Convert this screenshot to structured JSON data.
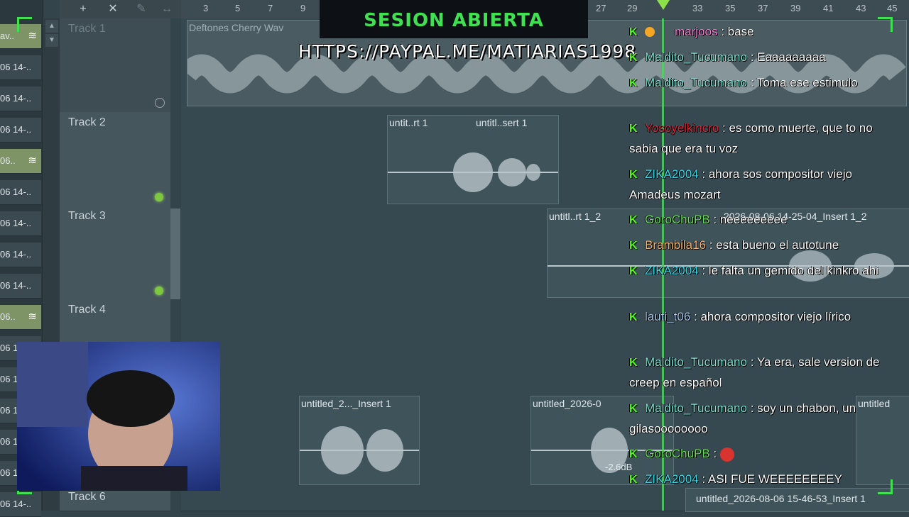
{
  "toolbar": {
    "add_icon": "+",
    "cut_icon": "✕",
    "pencil_icon": "✎",
    "stretch_icon": "↔"
  },
  "ruler": {
    "ticks": [
      "3",
      "5",
      "7",
      "9",
      "27",
      "29",
      "33",
      "35",
      "37",
      "39",
      "41",
      "43",
      "45"
    ]
  },
  "browser": {
    "items": [
      "av..",
      "06 14-..",
      "06 14-..",
      "06 14-..",
      "06..",
      "06 14-..",
      "06 14-..",
      "06 14-..",
      "06 14-..",
      "06..",
      "06 1",
      "06 1",
      "06 1",
      "06 1",
      "06 1",
      "06 14-.."
    ]
  },
  "tracks": [
    {
      "name": "Track 1"
    },
    {
      "name": "Track 2"
    },
    {
      "name": "Track 3"
    },
    {
      "name": "Track 4"
    },
    {
      "name": "Track 6"
    }
  ],
  "clips": {
    "t1_title": "Deftones  Cherry Wav",
    "t2_a": "untit..rt 1",
    "t2_b": "untitl..sert 1",
    "t3_a": "untitl..rt 1_2",
    "t3_b": "2026-08-06 14-25-04_Insert 1_2",
    "t5_a": "untitled_2..._Insert 1",
    "t5_b": "untitled_2026-0",
    "t5_c": "untitled",
    "t6_a": "untitled_2026-08-06 15-46-53_Insert 1",
    "db_label": "-2.6dB"
  },
  "overlay": {
    "banner": "SESION ABIERTA",
    "paypal": "HTTPS://PAYPAL.ME/MATIARIAS1998"
  },
  "chat": [
    {
      "user": "marjoos",
      "color": "#ff7ad9",
      "text": ": base"
    },
    {
      "user": "Maldito_Tucumano",
      "color": "#7be3d2",
      "text": ": Eaaaaaaaaa"
    },
    {
      "user": "Maldito_Tucumano",
      "color": "#7be3d2",
      "text": ": Toma ese estimulo"
    },
    {
      "user": "Yosoyelkincro",
      "color": "#e0253a",
      "text": ": es como muerte, que to no sabia que era tu voz"
    },
    {
      "user": "ZIKA2004",
      "color": "#36d9e8",
      "text": ": ahora sos compositor viejo Amadeus mozart"
    },
    {
      "user": "GoroChuPB",
      "color": "#62e04f",
      "text": ": neeeeeeeee"
    },
    {
      "user": "Brambila16",
      "color": "#f4b470",
      "text": ": esta bueno el autotune"
    },
    {
      "user": "ZIKA2004",
      "color": "#36d9e8",
      "text": ": le falta un gemido del kinkro ahi"
    },
    {
      "user": "lauti_t06",
      "color": "#a6c8ee",
      "text": ": ahora compositor viejo lírico"
    },
    {
      "user": "Maldito_Tucumano",
      "color": "#7be3d2",
      "text": ": Ya era, sale version de creep en español"
    },
    {
      "user": "Maldito_Tucumano",
      "color": "#7be3d2",
      "text": ": soy un chabon, un gilasoooooooo"
    },
    {
      "user": "GoroChuPB",
      "color": "#62e04f",
      "text": ":"
    },
    {
      "user": "ZIKA2004",
      "color": "#36d9e8",
      "text": ": ASI FUE WEEEEEEEEY"
    }
  ]
}
